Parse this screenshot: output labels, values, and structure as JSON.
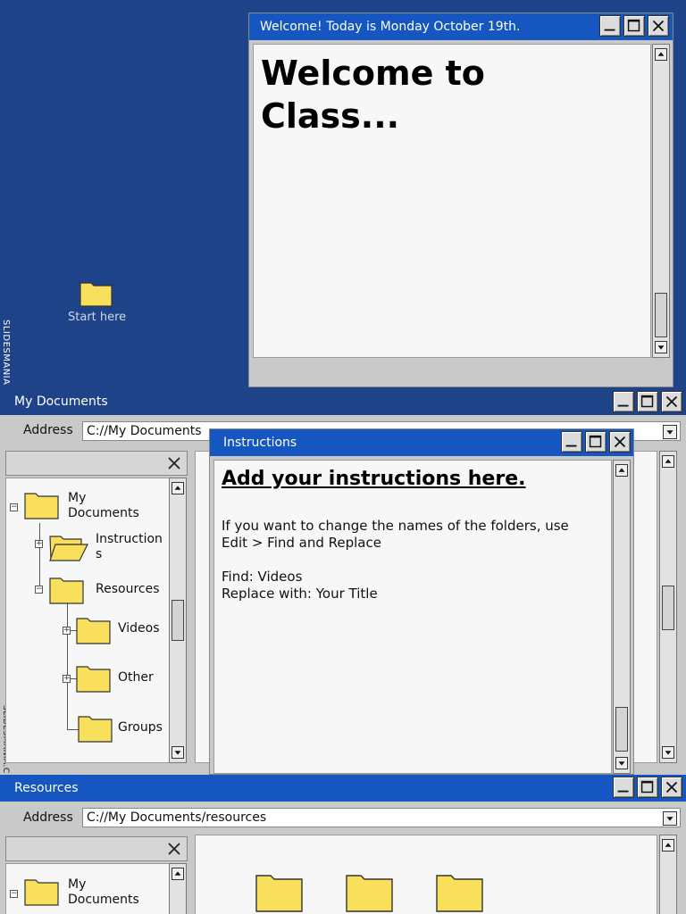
{
  "brand": {
    "watermark": "SLIDESMANIA",
    "watermark2": "SLIDESMANIA.C"
  },
  "colors": {
    "desktop": "#1f4388",
    "titlebar": "#1556c0",
    "folder": "#f9e05c"
  },
  "desktop": {
    "shortcut_label": "Start here"
  },
  "welcome_window": {
    "title": "Welcome! Today is Monday October 19th.",
    "heading": "Welcome to Class..."
  },
  "explorer": {
    "title": "My Documents",
    "address_label": "Address",
    "address_value": "C://My Documents",
    "tree": {
      "my_documents": "My Documents",
      "instructions": "Instruction s",
      "resources": "Resources",
      "videos": "Videos",
      "other": "Other",
      "groups": "Groups"
    }
  },
  "instructions_window": {
    "title": "Instructions",
    "heading": "Add your instructions here.",
    "line1": "If you want to change the names of the folders, use",
    "line2": "Edit > Find and Replace",
    "line3": "Find: Videos",
    "line4": "Replace with: Your Title"
  },
  "resources_window": {
    "title": "Resources",
    "address_label": "Address",
    "address_value": "C://My Documents/resources",
    "tree": {
      "my_documents": "My Documents"
    }
  },
  "icons": [
    "minimize-icon",
    "maximize-icon",
    "close-icon",
    "folder-icon",
    "open-folder-icon",
    "arrow-up-icon",
    "arrow-down-icon",
    "chevron-down-icon",
    "expand-icon",
    "collapse-icon"
  ]
}
